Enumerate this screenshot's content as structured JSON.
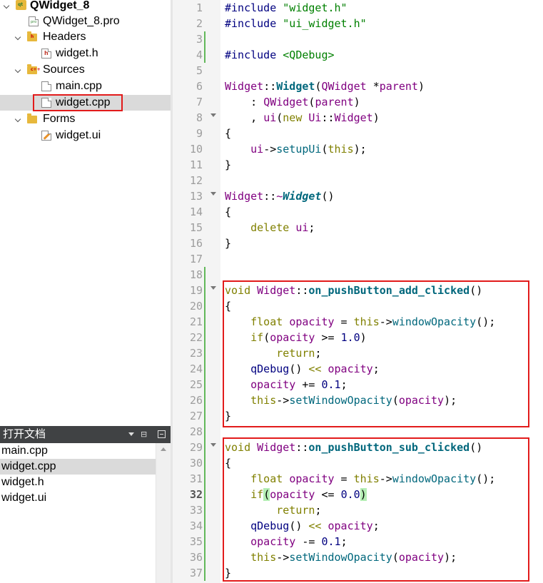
{
  "project_tree": {
    "project_name": "QWidget_8",
    "pro_file": "QWidget_8.pro",
    "headers_folder": "Headers",
    "header_file": "widget.h",
    "sources_folder": "Sources",
    "source_files": [
      "main.cpp",
      "widget.cpp"
    ],
    "forms_folder": "Forms",
    "form_file": "widget.ui",
    "selected": "widget.cpp"
  },
  "open_documents": {
    "title": "打开文档",
    "items": [
      "main.cpp",
      "widget.cpp",
      "widget.h",
      "widget.ui"
    ],
    "selected": "widget.cpp"
  },
  "editor": {
    "current_line": 32,
    "lines": [
      {
        "n": "1",
        "t": "#include \"widget.h\""
      },
      {
        "n": "2",
        "t": "#include \"ui_widget.h\""
      },
      {
        "n": "3",
        "t": ""
      },
      {
        "n": "4",
        "t": "#include <QDebug>"
      },
      {
        "n": "5",
        "t": ""
      },
      {
        "n": "6",
        "t": "Widget::Widget(QWidget *parent)"
      },
      {
        "n": "7",
        "t": "    : QWidget(parent)"
      },
      {
        "n": "8",
        "t": "    , ui(new Ui::Widget)"
      },
      {
        "n": "9",
        "t": "{"
      },
      {
        "n": "10",
        "t": "    ui->setupUi(this);"
      },
      {
        "n": "11",
        "t": "}"
      },
      {
        "n": "12",
        "t": ""
      },
      {
        "n": "13",
        "t": "Widget::~Widget()"
      },
      {
        "n": "14",
        "t": "{"
      },
      {
        "n": "15",
        "t": "    delete ui;"
      },
      {
        "n": "16",
        "t": "}"
      },
      {
        "n": "17",
        "t": ""
      },
      {
        "n": "18",
        "t": ""
      },
      {
        "n": "19",
        "t": "void Widget::on_pushButton_add_clicked()"
      },
      {
        "n": "20",
        "t": "{"
      },
      {
        "n": "21",
        "t": "    float opacity = this->windowOpacity();"
      },
      {
        "n": "22",
        "t": "    if(opacity >= 1.0)"
      },
      {
        "n": "23",
        "t": "        return;"
      },
      {
        "n": "24",
        "t": "    qDebug() << opacity;"
      },
      {
        "n": "25",
        "t": "    opacity += 0.1;"
      },
      {
        "n": "26",
        "t": "    this->setWindowOpacity(opacity);"
      },
      {
        "n": "27",
        "t": "}"
      },
      {
        "n": "28",
        "t": ""
      },
      {
        "n": "29",
        "t": "void Widget::on_pushButton_sub_clicked()"
      },
      {
        "n": "30",
        "t": "{"
      },
      {
        "n": "31",
        "t": "    float opacity = this->windowOpacity();"
      },
      {
        "n": "32",
        "t": "    if(opacity <= 0.0)"
      },
      {
        "n": "33",
        "t": "        return;"
      },
      {
        "n": "34",
        "t": "    qDebug() << opacity;"
      },
      {
        "n": "35",
        "t": "    opacity -= 0.1;"
      },
      {
        "n": "36",
        "t": "    this->setWindowOpacity(opacity);"
      },
      {
        "n": "37",
        "t": "}"
      }
    ]
  },
  "colors": {
    "highlight_box": "#e21b1b",
    "keyword": "#808000",
    "type": "#800080",
    "string": "#008000",
    "function": "#00677c",
    "number": "#000080",
    "modified_marker": "#62b85a",
    "panel_header_bg": "#404244",
    "selection_bg": "#dadada"
  }
}
